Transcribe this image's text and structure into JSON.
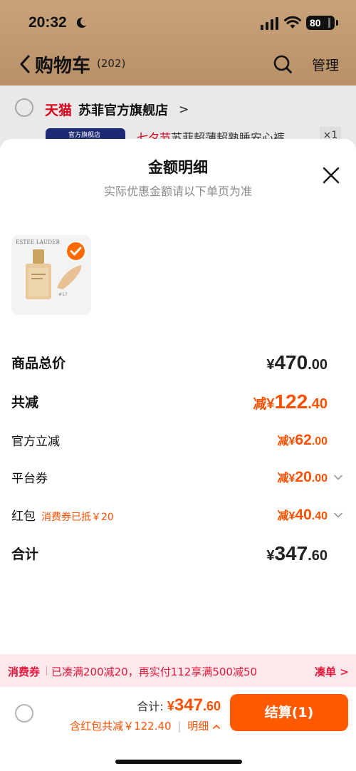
{
  "status_bar": {
    "time": "20:32",
    "battery": "80"
  },
  "nav": {
    "title": "购物车",
    "count": "(202)",
    "manage": "管理"
  },
  "store": {
    "platform": "天猫",
    "name": "苏菲官方旗舰店",
    "chevron": ">",
    "item_highlight": "七夕节",
    "item_title": "苏菲超薄超熟睡安心裤",
    "item_qty": "×1",
    "thumb_label": "官方旗舰店"
  },
  "sheet": {
    "title": "金额明细",
    "subtitle": "实际优惠金额请以下单页为准",
    "product": {
      "brand": "ESTEE LAUDER",
      "shade": "#17"
    },
    "rows": {
      "subtotal": {
        "label": "商品总价",
        "prefix": "",
        "currency": "¥",
        "int": "470",
        "dec": ".00"
      },
      "total_discount": {
        "label": "共减",
        "prefix": "减",
        "currency": "¥",
        "int": "122",
        "dec": ".40"
      },
      "official": {
        "label": "官方立减",
        "prefix": "减",
        "currency": "¥",
        "int": "62",
        "dec": ".00"
      },
      "platform_coupon": {
        "label": "平台券",
        "prefix": "减",
        "currency": "¥",
        "int": "20",
        "dec": ".00"
      },
      "red_packet": {
        "label": "红包",
        "note": "消费券已抵￥20",
        "prefix": "减",
        "currency": "¥",
        "int": "40",
        "dec": ".40"
      },
      "grand_total": {
        "label": "合计",
        "prefix": "",
        "currency": "¥",
        "int": "347",
        "dec": ".60"
      }
    }
  },
  "coupon_bar": {
    "tag": "消费券",
    "text": "已凑满200减20，再实付112享满500减50",
    "link": "凑单 >"
  },
  "footer": {
    "total_label": "合计:",
    "total_currency": "¥",
    "total_int": "347",
    "total_dec": ".60",
    "discount_text": "含红包共减￥122.40",
    "detail_sep": "|",
    "detail_link": "明细",
    "checkout": "结算(1)"
  },
  "colors": {
    "accent": "#ff5000",
    "coupon_red": "#e8163a",
    "checkout_bg": "#ff5a00",
    "tmall_red": "#d9001b"
  }
}
